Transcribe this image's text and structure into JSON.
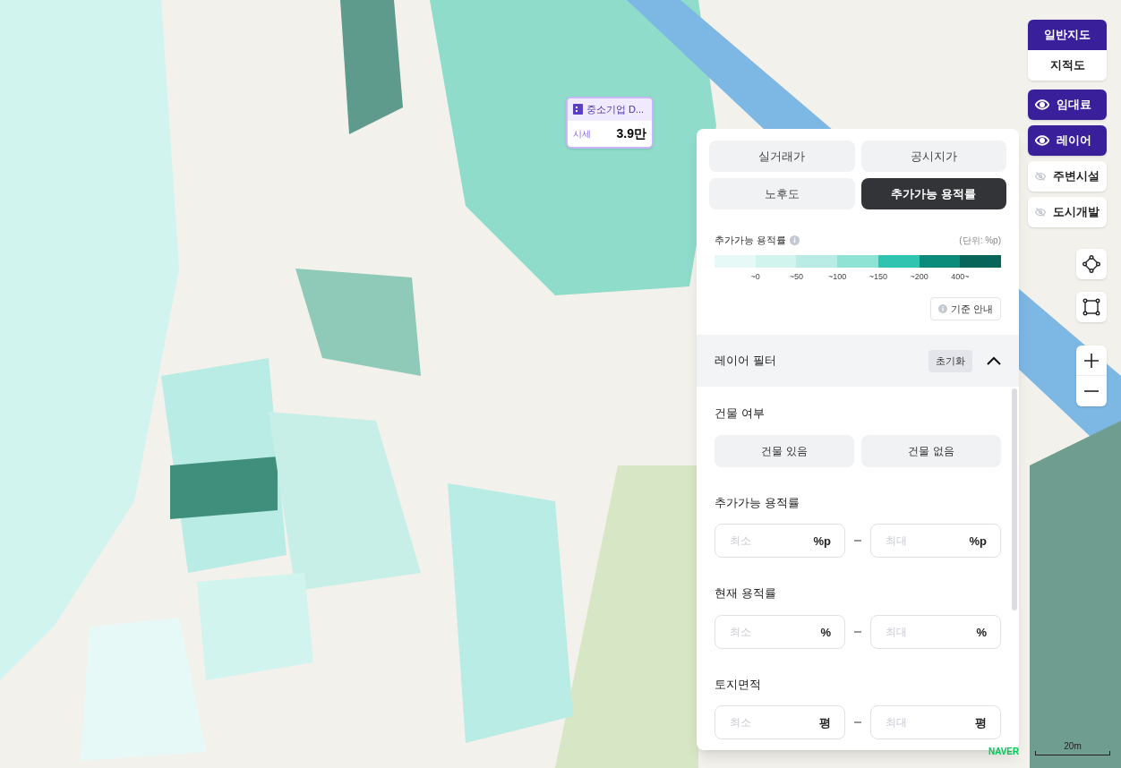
{
  "map_type_toggle": [
    {
      "label": "일반지도",
      "selected": true
    },
    {
      "label": "지적도",
      "selected": false
    }
  ],
  "layer_toggles": [
    {
      "label": "임대료",
      "on": true
    },
    {
      "label": "레이어",
      "on": true
    },
    {
      "label": "주변시설",
      "on": false
    },
    {
      "label": "도시개발",
      "on": false
    }
  ],
  "popup": {
    "title": "중소기업 D...",
    "label": "시세",
    "value": "3.9만"
  },
  "panel": {
    "tabs": [
      {
        "label": "실거래가",
        "selected": false
      },
      {
        "label": "공시지가",
        "selected": false
      },
      {
        "label": "노후도",
        "selected": false
      },
      {
        "label": "추가가능 용적률",
        "selected": true
      }
    ],
    "legend": {
      "title": "추가가능 용적률",
      "unit": "(단위: %p)",
      "steps": [
        {
          "color": "#e6f9f6"
        },
        {
          "color": "#d2f4ee"
        },
        {
          "color": "#b8ece4"
        },
        {
          "color": "#8fe3d5"
        },
        {
          "color": "#2ec4b0"
        },
        {
          "color": "#0b8c7a"
        },
        {
          "color": "#086559"
        }
      ],
      "labels": [
        "~0",
        "~50",
        "~100",
        "~150",
        "~200",
        "400~"
      ]
    },
    "guide_button": "기준 안내",
    "filter": {
      "title": "레이어 필터",
      "reset": "초기화",
      "expanded": true,
      "sections": [
        {
          "kind": "choice",
          "title": "건물 여부",
          "options": [
            {
              "label": "건물 있음",
              "selected": false
            },
            {
              "label": "건물 없음",
              "selected": false
            }
          ]
        },
        {
          "kind": "range",
          "title": "추가가능 용적률",
          "min_placeholder": "최소",
          "min_unit": "%p",
          "max_placeholder": "최대",
          "max_unit": "%p"
        },
        {
          "kind": "range",
          "title": "현재 용적률",
          "min_placeholder": "최소",
          "min_unit": "%",
          "max_placeholder": "최대",
          "max_unit": "%"
        },
        {
          "kind": "range",
          "title": "토지면적",
          "min_placeholder": "최소",
          "min_unit": "평",
          "max_placeholder": "최대",
          "max_unit": "평"
        }
      ]
    }
  },
  "scale": "20m",
  "logo": "NAVER"
}
